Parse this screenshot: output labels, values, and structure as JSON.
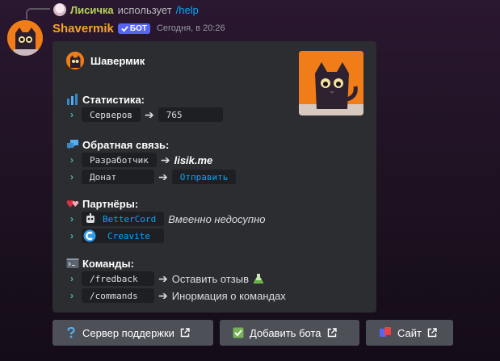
{
  "reply": {
    "user": "Лисичка",
    "action": "использует",
    "command": "/help"
  },
  "message": {
    "username": "Shavermik",
    "bot_tag": "БОТ",
    "timestamp": "Сегодня, в 20:26"
  },
  "embed": {
    "author": "Шавермик",
    "fields": {
      "stats": {
        "title": "Статистика:",
        "rows": [
          {
            "label": "Серверов",
            "value": "765"
          }
        ]
      },
      "feedback": {
        "title": "Обратная связь:",
        "rows": [
          {
            "label": "Разработчик",
            "value": "lisik.me"
          },
          {
            "label": "Донат",
            "value": "Отправить"
          }
        ]
      },
      "partners": {
        "title": "Партнёры:",
        "rows": [
          {
            "label": "BetterCord",
            "note": "Вмеенно недосупно"
          },
          {
            "label": "Creavite"
          }
        ]
      },
      "commands": {
        "title": "Команды:",
        "rows": [
          {
            "label": "/fredback",
            "value": "Оставить отзыв"
          },
          {
            "label": "/commands",
            "value": "Инормация о командах"
          }
        ]
      }
    }
  },
  "buttons": [
    {
      "label": "Сервер поддержки",
      "icon": "question-icon"
    },
    {
      "label": "Добавить бота",
      "icon": "check-box-icon"
    },
    {
      "label": "Сайт",
      "icon": "site-icon"
    }
  ],
  "colors": {
    "username": "#f5a623",
    "reply_user": "#b6d35a",
    "link": "#00a8fc",
    "bot_tag": "#5865f2",
    "embed_bg": "#2b2d31",
    "button_bg": "#4e5058"
  }
}
